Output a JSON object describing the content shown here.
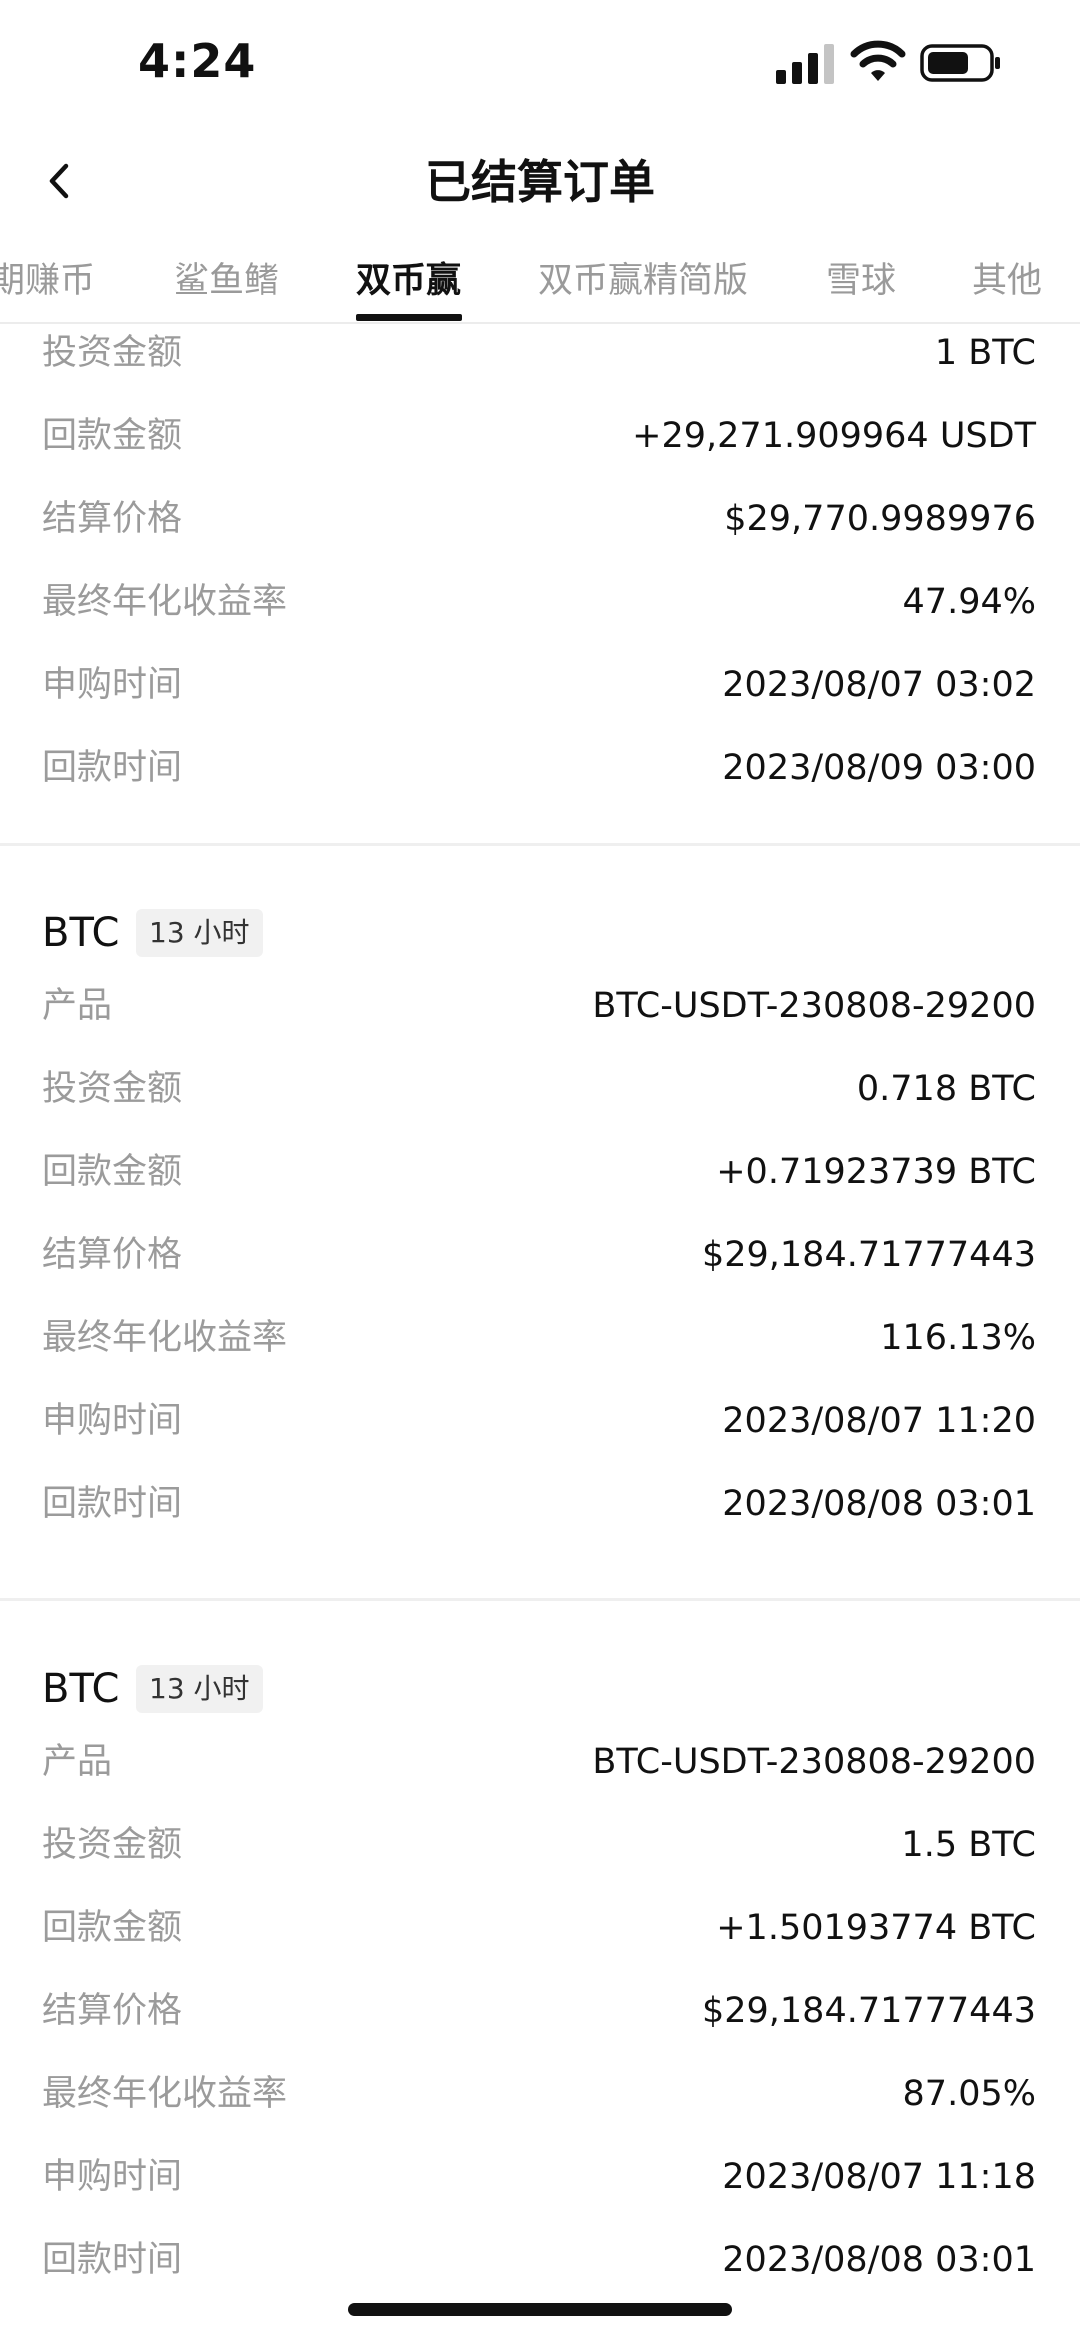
{
  "status": {
    "time": "4:24"
  },
  "header": {
    "title": "已结算订单"
  },
  "tabs": [
    "期赚币",
    "鲨鱼鳍",
    "双币赢",
    "双币赢精简版",
    "雪球",
    "其他"
  ],
  "active_tab": "双币赢",
  "partial_card": {
    "rows": [
      {
        "label": "投资金额",
        "value": "1 BTC"
      },
      {
        "label": "回款金额",
        "value": "+29,271.909964 USDT"
      },
      {
        "label": "结算价格",
        "value": "$29,770.9989976"
      },
      {
        "label": "最终年化收益率",
        "value": "47.94%"
      },
      {
        "label": "申购时间",
        "value": "2023/08/07 03:02"
      },
      {
        "label": "回款时间",
        "value": "2023/08/09 03:00"
      }
    ]
  },
  "cards": [
    {
      "coin": "BTC",
      "duration": "13 小时",
      "rows": [
        {
          "label": "产品",
          "value": "BTC-USDT-230808-29200"
        },
        {
          "label": "投资金额",
          "value": "0.718 BTC"
        },
        {
          "label": "回款金额",
          "value": "+0.71923739 BTC"
        },
        {
          "label": "结算价格",
          "value": "$29,184.71777443"
        },
        {
          "label": "最终年化收益率",
          "value": "116.13%"
        },
        {
          "label": "申购时间",
          "value": "2023/08/07 11:20"
        },
        {
          "label": "回款时间",
          "value": "2023/08/08 03:01"
        }
      ]
    },
    {
      "coin": "BTC",
      "duration": "13 小时",
      "rows": [
        {
          "label": "产品",
          "value": "BTC-USDT-230808-29200"
        },
        {
          "label": "投资金额",
          "value": "1.5 BTC"
        },
        {
          "label": "回款金额",
          "value": "+1.50193774 BTC"
        },
        {
          "label": "结算价格",
          "value": "$29,184.71777443"
        },
        {
          "label": "最终年化收益率",
          "value": "87.05%"
        },
        {
          "label": "申购时间",
          "value": "2023/08/07 11:18"
        },
        {
          "label": "回款时间",
          "value": "2023/08/08 03:01"
        }
      ]
    }
  ]
}
